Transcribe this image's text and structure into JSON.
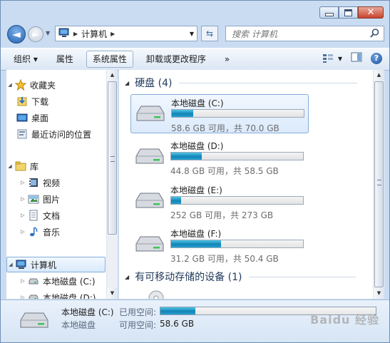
{
  "window": {
    "controls": {
      "minimize": "",
      "maximize": "",
      "close": "✕"
    }
  },
  "nav": {
    "back_glyph": "◄",
    "forward_glyph": "►",
    "breadcrumb": "计算机",
    "search_placeholder": "搜索 计算机"
  },
  "toolbar": {
    "organize": "组织 ▾",
    "properties": "属性",
    "system_properties": "系统属性",
    "uninstall": "卸载或更改程序",
    "more": "»",
    "view": "▾"
  },
  "sidebar": {
    "favorites": {
      "label": "收藏夹",
      "items": [
        "下载",
        "桌面",
        "最近访问的位置"
      ]
    },
    "libraries": {
      "label": "库",
      "items": [
        "视频",
        "图片",
        "文档",
        "音乐"
      ]
    },
    "computer": {
      "label": "计算机",
      "items": [
        "本地磁盘 (C:)",
        "本地磁盘 (D:)"
      ]
    }
  },
  "content": {
    "hard_disks": {
      "header": "硬盘 (4)",
      "drives": [
        {
          "name": "本地磁盘 (C:)",
          "info": "58.6 GB 可用，共 70.0 GB",
          "used_fraction": 0.163
        },
        {
          "name": "本地磁盘 (D:)",
          "info": "44.8 GB 可用，共 58.5 GB",
          "used_fraction": 0.234
        },
        {
          "name": "本地磁盘 (E:)",
          "info": "252 GB 可用，共 273 GB",
          "used_fraction": 0.077
        },
        {
          "name": "本地磁盘 (F:)",
          "info": "31.2 GB 可用，共 50.4 GB",
          "used_fraction": 0.381
        }
      ]
    },
    "removable": {
      "header": "有可移动存储的设备 (1)"
    }
  },
  "details": {
    "name": "本地磁盘 (C:)",
    "type": "本地磁盘",
    "used_label": "已用空间:",
    "free_label": "可用空间:",
    "free_value": "58.6 GB",
    "used_fraction": 0.163
  },
  "watermark": "Baidu 经验"
}
